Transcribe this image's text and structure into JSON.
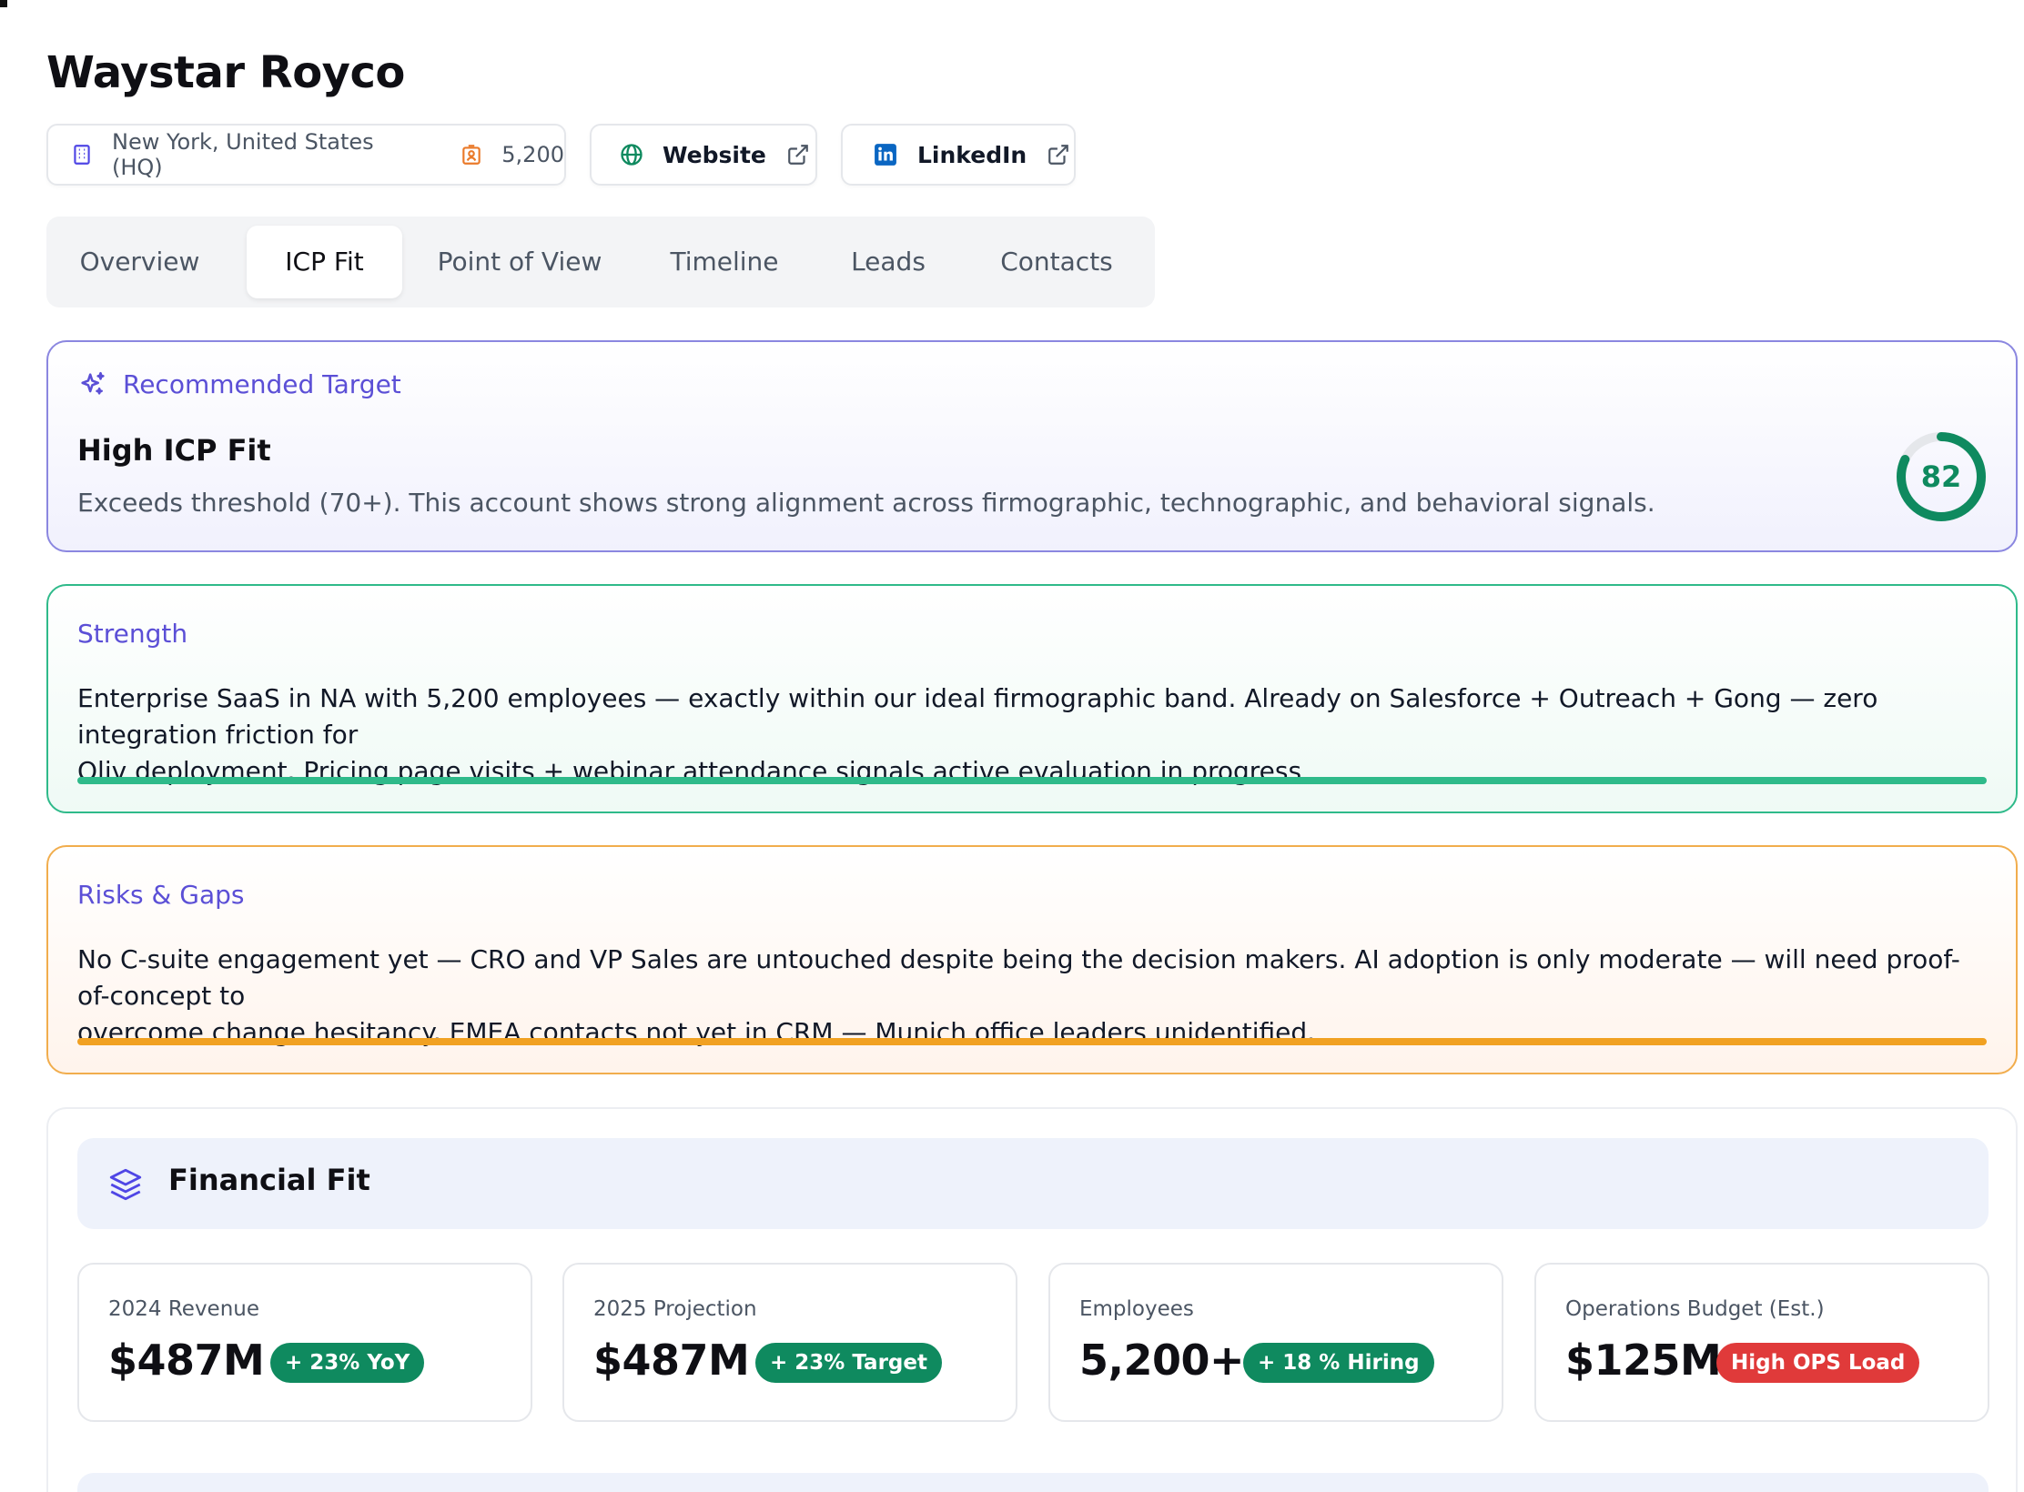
{
  "company": {
    "name": "Waystar Royco"
  },
  "info_chip": {
    "location": "New York, United States (HQ)",
    "employees": "5,200"
  },
  "links": {
    "website": "Website",
    "linkedin": "LinkedIn"
  },
  "tabs": [
    "Overview",
    "ICP Fit",
    "Point of View",
    "Timeline",
    "Leads",
    "Contacts"
  ],
  "active_tab": "ICP Fit",
  "recommendation": {
    "label": "Recommended Target",
    "title": "High ICP Fit",
    "description": "Exceeds threshold (70+). This account shows strong alignment across firmographic, technographic, and behavioral signals.",
    "score": "82",
    "score_value": 82,
    "score_max": 100
  },
  "strength": {
    "label": "Strength",
    "line1": "Enterprise SaaS in NA with 5,200 employees — exactly within our ideal firmographic band. Already on Salesforce + Outreach + Gong — zero integration friction for",
    "line2": "Oliv deployment. Pricing page visits + webinar attendance signals active evaluation in progress"
  },
  "risks": {
    "label": "Risks & Gaps",
    "line1": "No C-suite engagement yet — CRO and VP Sales are untouched despite being the decision makers. AI adoption is only moderate — will need proof-of-concept to",
    "line2": "overcome change hesitancy. EMEA contacts not yet in CRM — Munich office leaders unidentified."
  },
  "financial": {
    "title": "Financial Fit",
    "metrics": [
      {
        "label": "2024 Revenue",
        "value": "$487M",
        "badge": "+ 23% YoY",
        "badge_color": "#0f8a5f"
      },
      {
        "label": "2025 Projection",
        "value": "$487M",
        "badge": "+ 23% Target",
        "badge_color": "#0f8a5f"
      },
      {
        "label": "Employees",
        "value": "5,200+",
        "badge": "+ 18 % Hiring",
        "badge_color": "#0f8a5f"
      },
      {
        "label": "Operations Budget (Est.)",
        "value": "$125M",
        "badge": "High OPS Load",
        "badge_color": "#e03a3a"
      }
    ]
  },
  "colors": {
    "accent_purple": "#5b4fd6",
    "score_green": "#0f8a5f",
    "strength_bar": "#2fba8a",
    "risk_bar": "#f1a122"
  }
}
